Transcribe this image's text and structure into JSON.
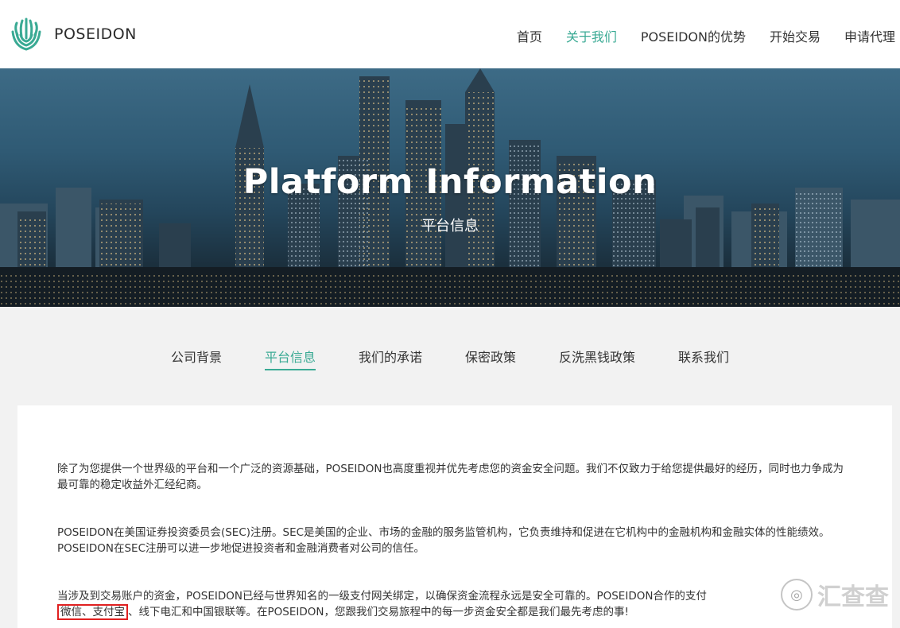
{
  "brand": {
    "name": "POSEIDON",
    "accent": "#3aaa94"
  },
  "nav": {
    "items": [
      {
        "label": "首页"
      },
      {
        "label": "关于我们"
      },
      {
        "label": "POSEIDON的优势"
      },
      {
        "label": "开始交易"
      },
      {
        "label": "申请代理"
      }
    ],
    "active_index": 1
  },
  "banner": {
    "title": "Platform Information",
    "subtitle": "平台信息"
  },
  "subtabs": {
    "items": [
      {
        "label": "公司背景"
      },
      {
        "label": "平台信息"
      },
      {
        "label": "我们的承诺"
      },
      {
        "label": "保密政策"
      },
      {
        "label": "反洗黑钱政策"
      },
      {
        "label": "联系我们"
      }
    ],
    "active_index": 1
  },
  "content": {
    "p1": "除了为您提供一个世界级的平台和一个广泛的资源基础，POSEIDON也高度重视并优先考虑您的资金安全问题。我们不仅致力于给您提供最好的经历，同时也力争成为最可靠的稳定收益外汇经纪商。",
    "p2": "POSEIDON在美国证券投资委员会(SEC)注册。SEC是美国的企业、市场的金融的服务监管机构，它负责维持和促进在它机构中的金融机构和金融实体的性能绩效。POSEIDON在SEC注册可以进一步地促进投资者和金融消费者对公司的信任。",
    "p3_a": "当涉及到交易账户的资金，POSEIDON已经与世界知名的一级支付网关绑定，以确保资金流程永远是安全可靠的。POSEIDON合作的支付",
    "p3_b": "微信、支付宝",
    "p3_c": "、线下电汇和中国银联等。在POSEIDON，您跟我们交易旅程中的每一步资金安全都是我们最先考虑的事!"
  },
  "watermark": {
    "text": "汇查查"
  }
}
